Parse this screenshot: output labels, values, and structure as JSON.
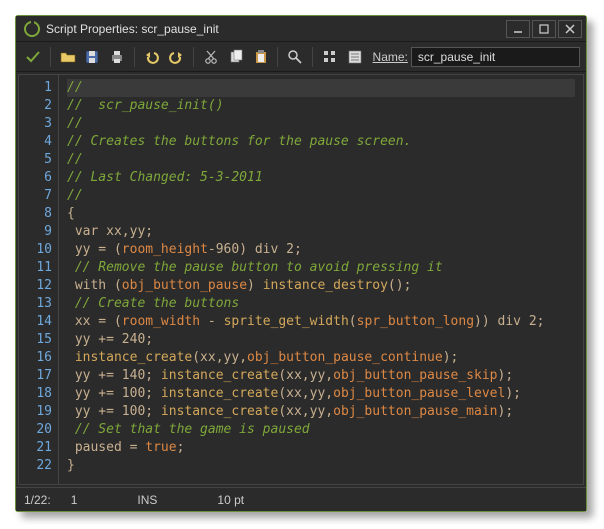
{
  "window": {
    "title": "Script Properties: scr_pause_init"
  },
  "toolbar": {
    "name_label": "Name:",
    "name_value": "scr_pause_init"
  },
  "code": {
    "lines": [
      {
        "n": 1,
        "t": "comment",
        "text": "//"
      },
      {
        "n": 2,
        "t": "comment",
        "text": "//  scr_pause_init()"
      },
      {
        "n": 3,
        "t": "comment",
        "text": "//"
      },
      {
        "n": 4,
        "t": "comment",
        "text": "// Creates the buttons for the pause screen."
      },
      {
        "n": 5,
        "t": "comment",
        "text": "//"
      },
      {
        "n": 6,
        "t": "comment",
        "text": "// Last Changed: 5-3-2011"
      },
      {
        "n": 7,
        "t": "comment",
        "text": "//"
      },
      {
        "n": 8,
        "t": "brace",
        "text": "{"
      },
      {
        "n": 9,
        "t": "code",
        "html": " <span class='kw'>var</span> xx,yy;"
      },
      {
        "n": 10,
        "t": "code",
        "html": " yy = (<span class='bi'>room_height</span>-960) <span class='kw'>div</span> 2;"
      },
      {
        "n": 11,
        "t": "comment",
        "text": " // Remove the pause button to avoid pressing it"
      },
      {
        "n": 12,
        "t": "code",
        "html": " <span class='kw'>with</span> (<span class='ob'>obj_button_pause</span>) <span class='fn'>instance_destroy</span>();"
      },
      {
        "n": 13,
        "t": "comment",
        "text": " // Create the buttons"
      },
      {
        "n": 14,
        "t": "code",
        "html": " xx = (<span class='bi'>room_width</span> - <span class='fn'>sprite_get_width</span>(<span class='ob'>spr_button_long</span>)) <span class='kw'>div</span> 2;"
      },
      {
        "n": 15,
        "t": "code",
        "html": " yy += 240;"
      },
      {
        "n": 16,
        "t": "code",
        "html": " <span class='fn'>instance_create</span>(xx,yy,<span class='ob'>obj_button_pause_continue</span>);"
      },
      {
        "n": 17,
        "t": "code",
        "html": " yy += 140; <span class='fn'>instance_create</span>(xx,yy,<span class='ob'>obj_button_pause_skip</span>);"
      },
      {
        "n": 18,
        "t": "code",
        "html": " yy += 100; <span class='fn'>instance_create</span>(xx,yy,<span class='ob'>obj_button_pause_level</span>);"
      },
      {
        "n": 19,
        "t": "code",
        "html": " yy += 100; <span class='fn'>instance_create</span>(xx,yy,<span class='ob'>obj_button_pause_main</span>);"
      },
      {
        "n": 20,
        "t": "comment",
        "text": " // Set that the game is paused"
      },
      {
        "n": 21,
        "t": "code",
        "html": " paused = <span class='tr'>true</span>;"
      },
      {
        "n": 22,
        "t": "brace",
        "text": "}"
      }
    ]
  },
  "status": {
    "pos": "1/22:",
    "col": "1",
    "mode": "INS",
    "font": "10 pt"
  }
}
